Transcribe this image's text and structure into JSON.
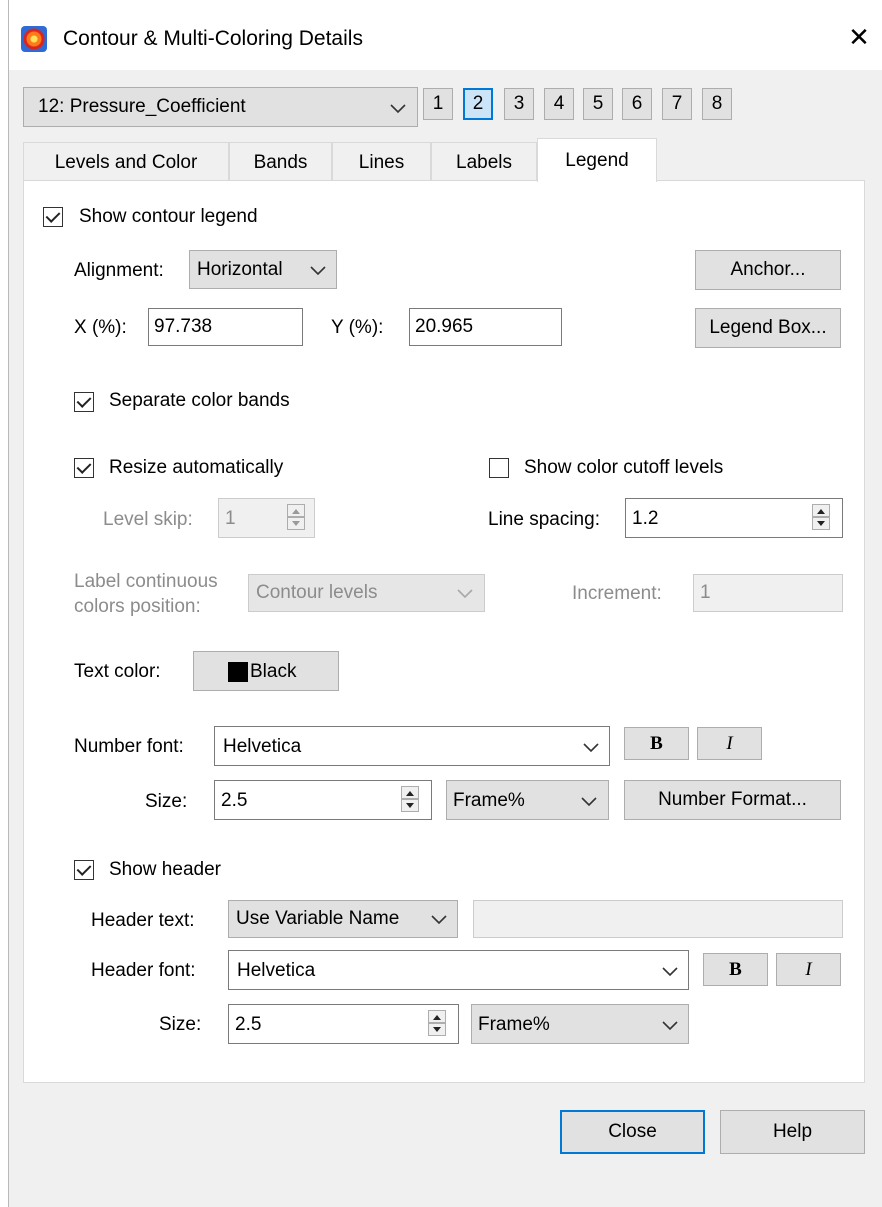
{
  "window": {
    "title": "Contour & Multi-Coloring Details",
    "close_glyph": "✕"
  },
  "variable_select": {
    "value": "12: Pressure_Coefficient"
  },
  "group_buttons": [
    "1",
    "2",
    "3",
    "4",
    "5",
    "6",
    "7",
    "8"
  ],
  "selected_group": "2",
  "tabs": [
    "Levels and Color",
    "Bands",
    "Lines",
    "Labels",
    "Legend"
  ],
  "active_tab": "Legend",
  "legend": {
    "show_contour_legend": {
      "label": "Show contour legend",
      "checked": true
    },
    "alignment": {
      "label": "Alignment:",
      "value": "Horizontal"
    },
    "anchor_button": "Anchor...",
    "x": {
      "label": "X (%):",
      "value": "97.738"
    },
    "y": {
      "label": "Y (%):",
      "value": "20.965"
    },
    "legend_box_button": "Legend Box...",
    "separate_color_bands": {
      "label": "Separate color bands",
      "checked": true
    },
    "resize_automatically": {
      "label": "Resize automatically",
      "checked": true
    },
    "show_color_cutoff": {
      "label": "Show color cutoff levels",
      "checked": false
    },
    "level_skip": {
      "label": "Level skip:",
      "value": "1"
    },
    "line_spacing": {
      "label": "Line spacing:",
      "value": "1.2"
    },
    "label_continuous": {
      "label_line1": "Label continuous",
      "label_line2": "colors position:",
      "value": "Contour levels"
    },
    "increment": {
      "label": "Increment:",
      "value": "1"
    },
    "text_color": {
      "label": "Text color:",
      "value": "Black",
      "swatch": "#000000"
    },
    "number_font": {
      "label": "Number font:",
      "value": "Helvetica",
      "bold": "B",
      "italic": "I"
    },
    "number_size": {
      "label": "Size:",
      "value": "2.5",
      "units": "Frame%",
      "format_button": "Number Format..."
    },
    "show_header": {
      "label": "Show header",
      "checked": true
    },
    "header_text": {
      "label": "Header text:",
      "value": "Use Variable Name",
      "custom_value": ""
    },
    "header_font": {
      "label": "Header font:",
      "value": "Helvetica",
      "bold": "B",
      "italic": "I"
    },
    "header_size": {
      "label": "Size:",
      "value": "2.5",
      "units": "Frame%"
    }
  },
  "footer": {
    "close": "Close",
    "help": "Help"
  }
}
